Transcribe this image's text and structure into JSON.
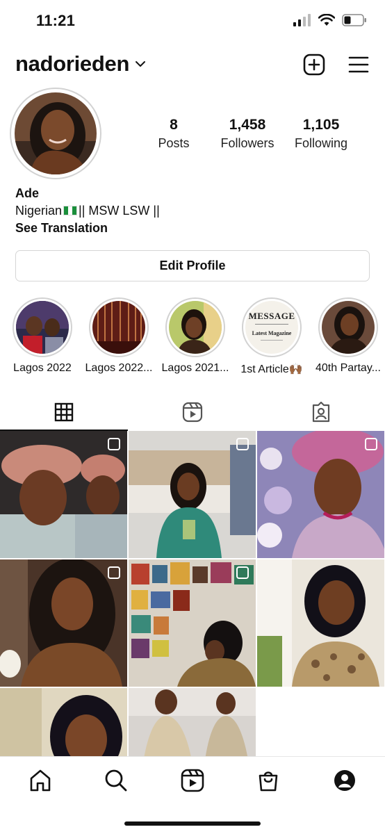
{
  "status_bar": {
    "time": "11:21"
  },
  "header": {
    "username": "nadorieden"
  },
  "profile": {
    "stats": [
      {
        "num": "8",
        "label": "Posts"
      },
      {
        "num": "1,458",
        "label": "Followers"
      },
      {
        "num": "1,105",
        "label": "Following"
      }
    ],
    "name": "Ade",
    "bio_prefix": "Nigerian",
    "bio_suffix": "|| MSW LSW ||",
    "see_translation": "See Translation",
    "edit_profile": "Edit Profile"
  },
  "highlights": [
    {
      "label": "Lagos 2022"
    },
    {
      "label": "Lagos 2022..."
    },
    {
      "label": "Lagos 2021..."
    },
    {
      "label": "1st Article🙌🏾",
      "cover_title": "MESSAGE",
      "cover_subtitle": "Latest Magazine"
    },
    {
      "label": "40th Partay..."
    }
  ],
  "tabs": [
    "grid-tab",
    "reels-tab",
    "tagged-tab"
  ],
  "colors": {
    "accent": "#111111",
    "border": "#d2d2d2"
  }
}
